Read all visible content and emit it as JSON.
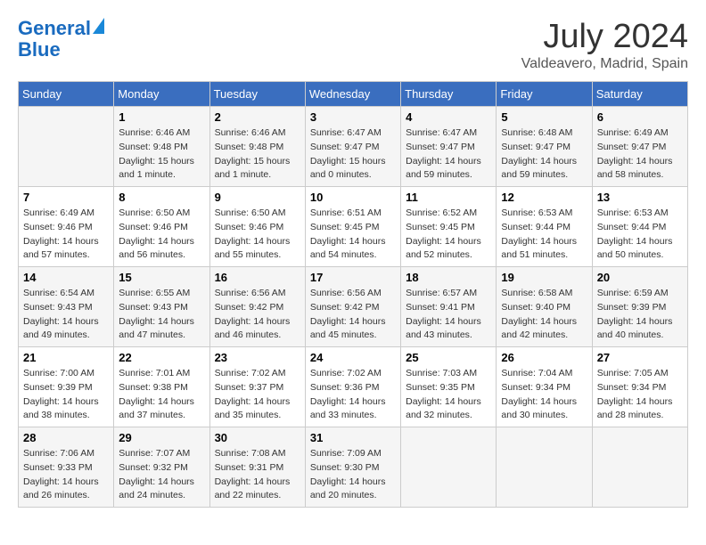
{
  "header": {
    "logo_line1": "General",
    "logo_line2": "Blue",
    "month": "July 2024",
    "location": "Valdeavero, Madrid, Spain"
  },
  "days_of_week": [
    "Sunday",
    "Monday",
    "Tuesday",
    "Wednesday",
    "Thursday",
    "Friday",
    "Saturday"
  ],
  "weeks": [
    [
      {
        "day": "",
        "sunrise": "",
        "sunset": "",
        "daylight": ""
      },
      {
        "day": "1",
        "sunrise": "Sunrise: 6:46 AM",
        "sunset": "Sunset: 9:48 PM",
        "daylight": "Daylight: 15 hours and 1 minute."
      },
      {
        "day": "2",
        "sunrise": "Sunrise: 6:46 AM",
        "sunset": "Sunset: 9:48 PM",
        "daylight": "Daylight: 15 hours and 1 minute."
      },
      {
        "day": "3",
        "sunrise": "Sunrise: 6:47 AM",
        "sunset": "Sunset: 9:47 PM",
        "daylight": "Daylight: 15 hours and 0 minutes."
      },
      {
        "day": "4",
        "sunrise": "Sunrise: 6:47 AM",
        "sunset": "Sunset: 9:47 PM",
        "daylight": "Daylight: 14 hours and 59 minutes."
      },
      {
        "day": "5",
        "sunrise": "Sunrise: 6:48 AM",
        "sunset": "Sunset: 9:47 PM",
        "daylight": "Daylight: 14 hours and 59 minutes."
      },
      {
        "day": "6",
        "sunrise": "Sunrise: 6:49 AM",
        "sunset": "Sunset: 9:47 PM",
        "daylight": "Daylight: 14 hours and 58 minutes."
      }
    ],
    [
      {
        "day": "7",
        "sunrise": "Sunrise: 6:49 AM",
        "sunset": "Sunset: 9:46 PM",
        "daylight": "Daylight: 14 hours and 57 minutes."
      },
      {
        "day": "8",
        "sunrise": "Sunrise: 6:50 AM",
        "sunset": "Sunset: 9:46 PM",
        "daylight": "Daylight: 14 hours and 56 minutes."
      },
      {
        "day": "9",
        "sunrise": "Sunrise: 6:50 AM",
        "sunset": "Sunset: 9:46 PM",
        "daylight": "Daylight: 14 hours and 55 minutes."
      },
      {
        "day": "10",
        "sunrise": "Sunrise: 6:51 AM",
        "sunset": "Sunset: 9:45 PM",
        "daylight": "Daylight: 14 hours and 54 minutes."
      },
      {
        "day": "11",
        "sunrise": "Sunrise: 6:52 AM",
        "sunset": "Sunset: 9:45 PM",
        "daylight": "Daylight: 14 hours and 52 minutes."
      },
      {
        "day": "12",
        "sunrise": "Sunrise: 6:53 AM",
        "sunset": "Sunset: 9:44 PM",
        "daylight": "Daylight: 14 hours and 51 minutes."
      },
      {
        "day": "13",
        "sunrise": "Sunrise: 6:53 AM",
        "sunset": "Sunset: 9:44 PM",
        "daylight": "Daylight: 14 hours and 50 minutes."
      }
    ],
    [
      {
        "day": "14",
        "sunrise": "Sunrise: 6:54 AM",
        "sunset": "Sunset: 9:43 PM",
        "daylight": "Daylight: 14 hours and 49 minutes."
      },
      {
        "day": "15",
        "sunrise": "Sunrise: 6:55 AM",
        "sunset": "Sunset: 9:43 PM",
        "daylight": "Daylight: 14 hours and 47 minutes."
      },
      {
        "day": "16",
        "sunrise": "Sunrise: 6:56 AM",
        "sunset": "Sunset: 9:42 PM",
        "daylight": "Daylight: 14 hours and 46 minutes."
      },
      {
        "day": "17",
        "sunrise": "Sunrise: 6:56 AM",
        "sunset": "Sunset: 9:42 PM",
        "daylight": "Daylight: 14 hours and 45 minutes."
      },
      {
        "day": "18",
        "sunrise": "Sunrise: 6:57 AM",
        "sunset": "Sunset: 9:41 PM",
        "daylight": "Daylight: 14 hours and 43 minutes."
      },
      {
        "day": "19",
        "sunrise": "Sunrise: 6:58 AM",
        "sunset": "Sunset: 9:40 PM",
        "daylight": "Daylight: 14 hours and 42 minutes."
      },
      {
        "day": "20",
        "sunrise": "Sunrise: 6:59 AM",
        "sunset": "Sunset: 9:39 PM",
        "daylight": "Daylight: 14 hours and 40 minutes."
      }
    ],
    [
      {
        "day": "21",
        "sunrise": "Sunrise: 7:00 AM",
        "sunset": "Sunset: 9:39 PM",
        "daylight": "Daylight: 14 hours and 38 minutes."
      },
      {
        "day": "22",
        "sunrise": "Sunrise: 7:01 AM",
        "sunset": "Sunset: 9:38 PM",
        "daylight": "Daylight: 14 hours and 37 minutes."
      },
      {
        "day": "23",
        "sunrise": "Sunrise: 7:02 AM",
        "sunset": "Sunset: 9:37 PM",
        "daylight": "Daylight: 14 hours and 35 minutes."
      },
      {
        "day": "24",
        "sunrise": "Sunrise: 7:02 AM",
        "sunset": "Sunset: 9:36 PM",
        "daylight": "Daylight: 14 hours and 33 minutes."
      },
      {
        "day": "25",
        "sunrise": "Sunrise: 7:03 AM",
        "sunset": "Sunset: 9:35 PM",
        "daylight": "Daylight: 14 hours and 32 minutes."
      },
      {
        "day": "26",
        "sunrise": "Sunrise: 7:04 AM",
        "sunset": "Sunset: 9:34 PM",
        "daylight": "Daylight: 14 hours and 30 minutes."
      },
      {
        "day": "27",
        "sunrise": "Sunrise: 7:05 AM",
        "sunset": "Sunset: 9:34 PM",
        "daylight": "Daylight: 14 hours and 28 minutes."
      }
    ],
    [
      {
        "day": "28",
        "sunrise": "Sunrise: 7:06 AM",
        "sunset": "Sunset: 9:33 PM",
        "daylight": "Daylight: 14 hours and 26 minutes."
      },
      {
        "day": "29",
        "sunrise": "Sunrise: 7:07 AM",
        "sunset": "Sunset: 9:32 PM",
        "daylight": "Daylight: 14 hours and 24 minutes."
      },
      {
        "day": "30",
        "sunrise": "Sunrise: 7:08 AM",
        "sunset": "Sunset: 9:31 PM",
        "daylight": "Daylight: 14 hours and 22 minutes."
      },
      {
        "day": "31",
        "sunrise": "Sunrise: 7:09 AM",
        "sunset": "Sunset: 9:30 PM",
        "daylight": "Daylight: 14 hours and 20 minutes."
      },
      {
        "day": "",
        "sunrise": "",
        "sunset": "",
        "daylight": ""
      },
      {
        "day": "",
        "sunrise": "",
        "sunset": "",
        "daylight": ""
      },
      {
        "day": "",
        "sunrise": "",
        "sunset": "",
        "daylight": ""
      }
    ]
  ]
}
